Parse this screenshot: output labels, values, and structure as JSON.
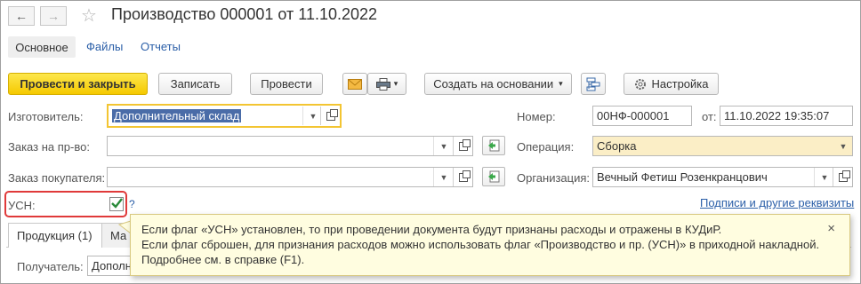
{
  "window": {
    "title": "Производство 000001 от 11.10.2022"
  },
  "nav": {
    "back_icon": "←",
    "forward_icon": "→",
    "star_icon": "☆"
  },
  "tabs": {
    "main": "Основное",
    "files": "Файлы",
    "reports": "Отчеты"
  },
  "toolbar": {
    "post_close": "Провести и закрыть",
    "write": "Записать",
    "post": "Провести",
    "create_based": "Создать на основании",
    "settings": "Настройка",
    "dropdown_glyph": "▾"
  },
  "form": {
    "manufacturer_label": "Изготовитель:",
    "manufacturer_value": "Дополнительный склад",
    "production_order_label": "Заказ на пр-во:",
    "production_order_value": "",
    "customer_order_label": "Заказ покупателя:",
    "customer_order_value": "",
    "usn_label": "УСН:",
    "usn_help": "?",
    "number_label": "Номер:",
    "number_value": "00НФ-000001",
    "date_label": "от:",
    "date_value": "11.10.2022 19:35:07",
    "operation_label": "Операция:",
    "operation_value": "Сборка",
    "organization_label": "Организация:",
    "organization_value": "Вечный Фетиш Розенкранцович",
    "signatures_link": "Подписи и другие реквизиты"
  },
  "bottom_tabs": {
    "products": "Продукция (1)",
    "materials": "Ма"
  },
  "recipient": {
    "label": "Получатель:",
    "value": "Дополн"
  },
  "tooltip": {
    "line1": "Если флаг «УСН» установлен, то при проведении документа будут признаны расходы и отражены в КУДиР.",
    "line2": "Если флаг сброшен, для признания расходов можно использовать флаг «Производство и пр. (УСН)» в приходной накладной.",
    "line3": "Подробнее см. в справке (F1).",
    "close": "×"
  },
  "colors": {
    "primary_button": "#f5c900",
    "link": "#2b5fa8",
    "highlight_box": "#e03a3a",
    "tooltip_bg": "#fffde0"
  }
}
